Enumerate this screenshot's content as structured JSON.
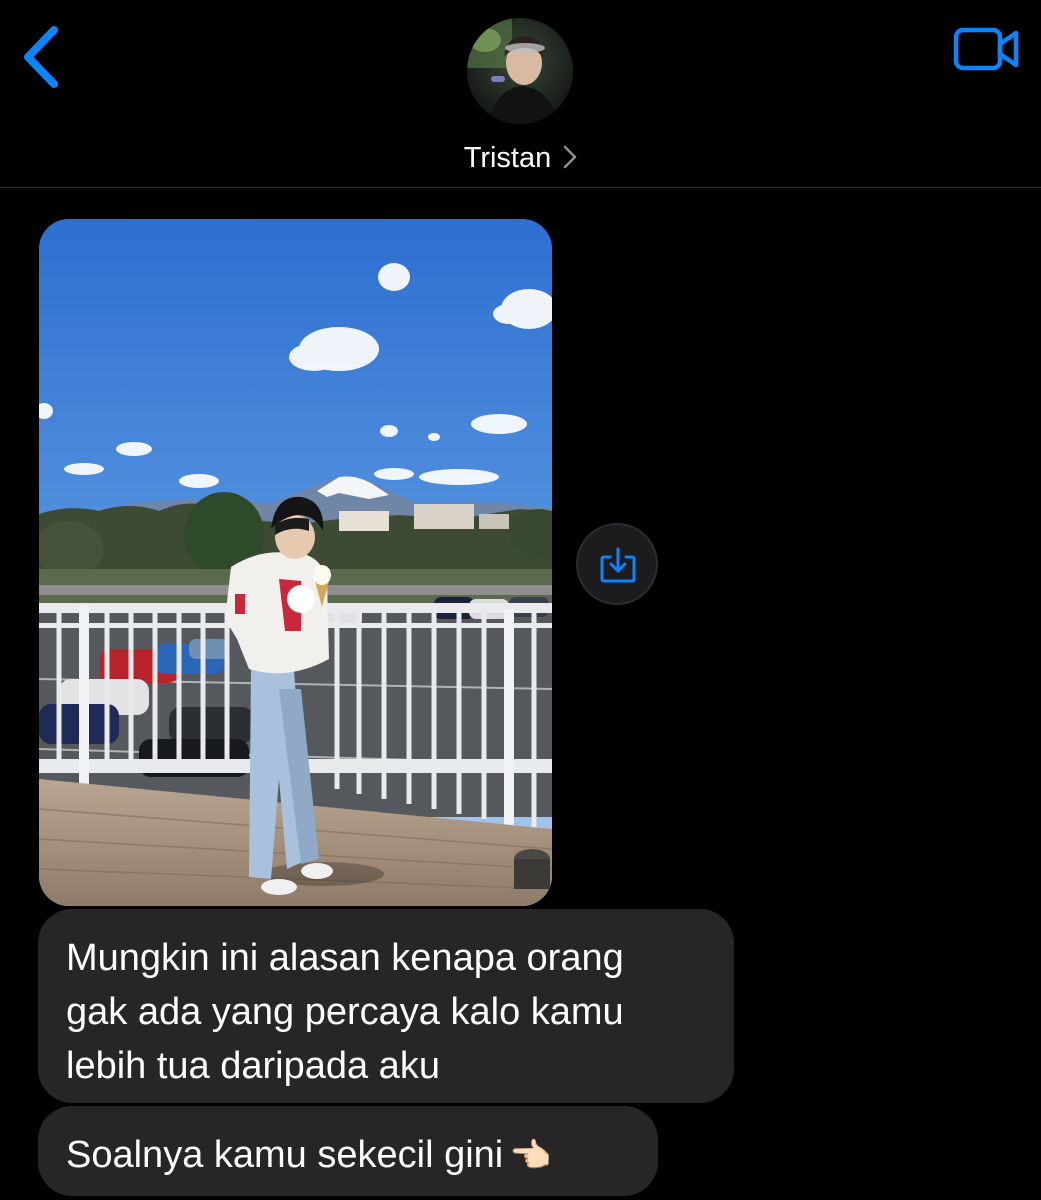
{
  "header": {
    "contact_name": "Tristan",
    "back_icon": "chevron-left-icon",
    "video_icon": "video-camera-icon",
    "avatar": "contact-avatar-photo",
    "accent_color": "#0a84ff"
  },
  "messages": [
    {
      "type": "photo",
      "description_icon": "photo-attachment",
      "save_icon": "save-download-icon"
    },
    {
      "type": "text",
      "lines": [
        "Mungkin ini alasan kenapa orang",
        "gak ada yang percaya kalo kamu",
        "lebih tua daripada aku"
      ]
    },
    {
      "type": "text",
      "text": "Soalnya kamu sekecil gini",
      "emoji": "👈🏻"
    }
  ],
  "colors": {
    "background": "#000000",
    "bubble_incoming": "#262629",
    "text": "#ffffff"
  }
}
